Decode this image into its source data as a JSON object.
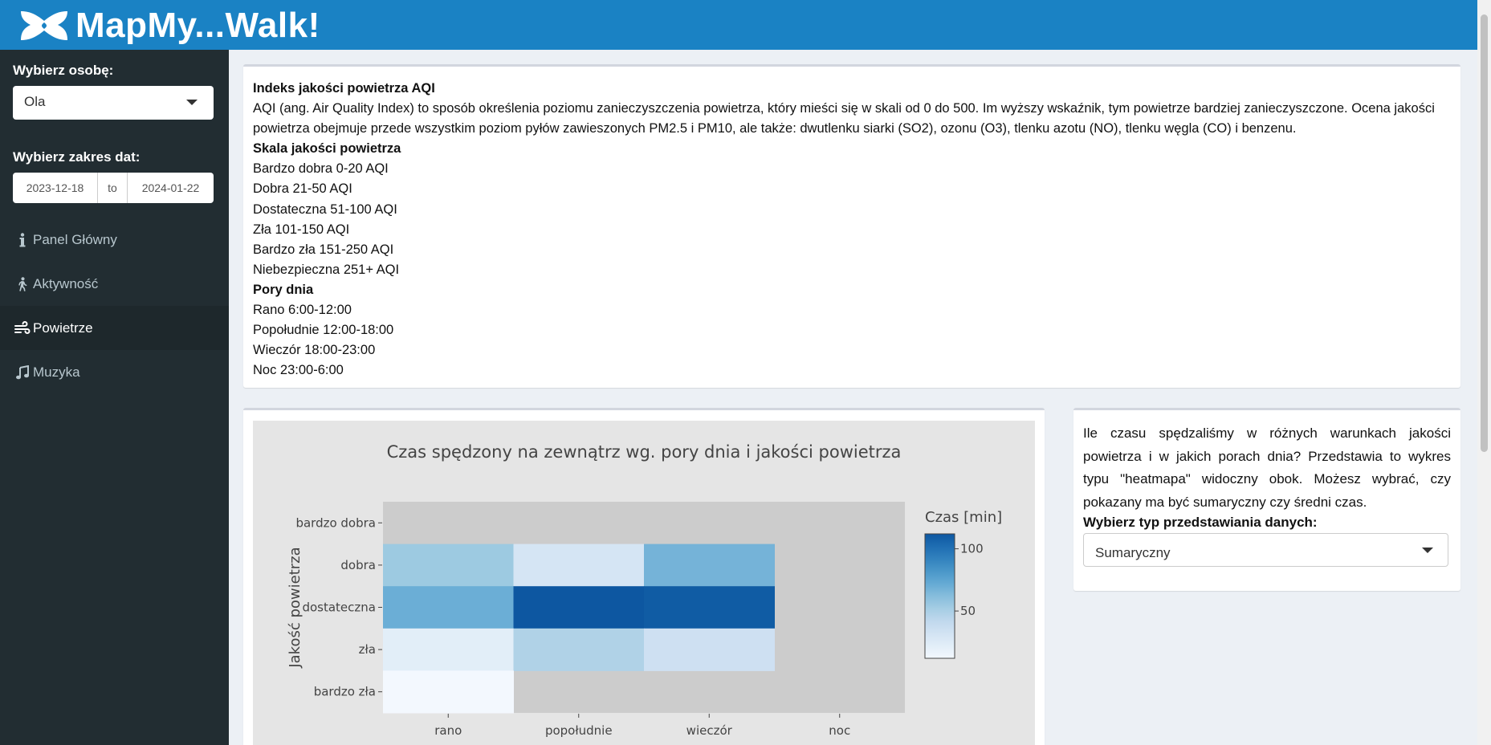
{
  "app": {
    "title": "MapMy...Walk!"
  },
  "sidebar": {
    "person_label": "Wybierz osobę:",
    "person_value": "Ola",
    "date_label": "Wybierz zakres dat:",
    "date_start": "2023-12-18",
    "date_sep": "to",
    "date_end": "2024-01-22",
    "menu": [
      {
        "label": "Panel Główny",
        "icon": "info-icon"
      },
      {
        "label": "Aktywność",
        "icon": "walking-icon"
      },
      {
        "label": "Powietrze",
        "icon": "wind-icon",
        "active": true
      },
      {
        "label": "Muzyka",
        "icon": "music-icon"
      }
    ]
  },
  "info": {
    "title": "Indeks jakości powietrza AQI",
    "description": "AQI (ang. Air Quality Index) to sposób określenia poziomu zanieczyszczenia powietrza, który mieści się w skali od 0 do 500. Im wyższy wskaźnik, tym powietrze bardziej zanieczyszczone. Ocena jakości powietrza obejmuje przede wszystkim poziom pyłów zawieszonych PM2.5 i PM10, ale także: dwutlenku siarki (SO2), ozonu (O3), tlenku azotu (NO), tlenku węgla (CO) i benzenu.",
    "scale_title": "Skala jakości powietrza",
    "scale": [
      "Bardzo dobra 0-20 AQI",
      "Dobra 21-50 AQI",
      "Dostateczna 51-100 AQI",
      "Zła 101-150 AQI",
      "Bardzo zła 151-250 AQI",
      "Niebezpieczna 251+ AQI"
    ],
    "times_title": "Pory dnia",
    "times": [
      "Rano 6:00-12:00",
      "Popołudnie 12:00-18:00",
      "Wieczór 18:00-23:00",
      "Noc 23:00-6:00"
    ]
  },
  "side": {
    "text": "Ile czasu spędzaliśmy w różnych warunkach jakości powietrza i w jakich porach dnia? Przedstawia to wykres typu \"heatmapa\" widoczny obok. Możesz wybrać, czy pokazany ma być sumaryczny czy średni czas.",
    "select_label": "Wybierz typ przedstawiania danych:",
    "select_value": "Sumaryczny"
  },
  "colors": {
    "header": "#1a82c4",
    "sidebar": "#222d32",
    "panel_bg": "#e5e5e5",
    "na_cell": "#cccccc"
  },
  "chart_data": {
    "type": "heatmap",
    "title": "Czas spędzony na zewnątrz wg. pory dnia i jakości powietrza",
    "xlabel": "",
    "ylabel": "Jakość powietrza",
    "x_categories": [
      "rano",
      "popołudnie",
      "wieczór",
      "noc"
    ],
    "y_categories": [
      "bardzo dobra",
      "dobra",
      "dostateczna",
      "zła",
      "bardzo zła"
    ],
    "values": [
      [
        null,
        null,
        null,
        null
      ],
      [
        55,
        30,
        67,
        null
      ],
      [
        70,
        112,
        110,
        null
      ],
      [
        22,
        48,
        35,
        null
      ],
      [
        12,
        null,
        null,
        null
      ]
    ],
    "colorbar": {
      "title": "Czas [min]",
      "ticks": [
        50,
        100
      ],
      "min": 12,
      "max": 112
    }
  }
}
